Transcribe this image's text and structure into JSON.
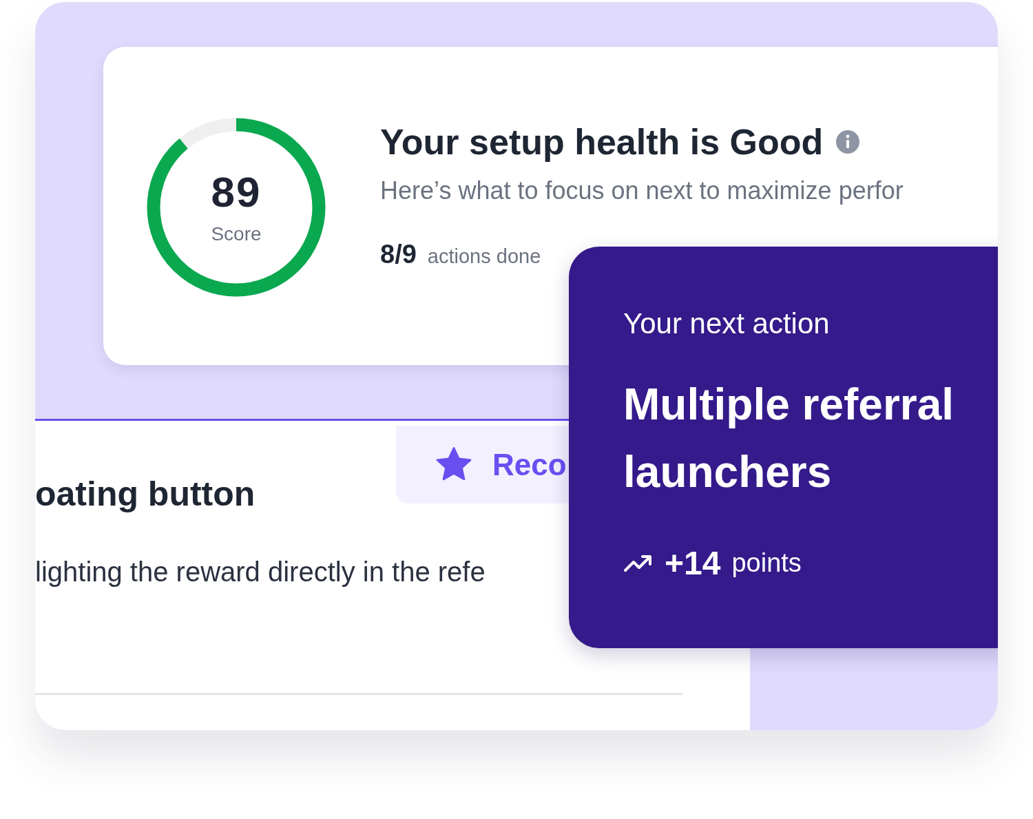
{
  "health_card": {
    "score": {
      "value": "89",
      "label": "Score",
      "level": 0.89
    },
    "title": "Your setup health is Good",
    "subtitle": "Here’s what to focus on next to maximize perfor",
    "progress": {
      "count": "8/9",
      "label": "actions done"
    }
  },
  "recommendation": {
    "tag": "Reco",
    "title": "oating button",
    "description": "lighting the reward directly in the refe"
  },
  "next_action": {
    "heading": "Your next action",
    "title": "Multiple referral launchers",
    "points": "+14",
    "points_label": "points"
  }
}
